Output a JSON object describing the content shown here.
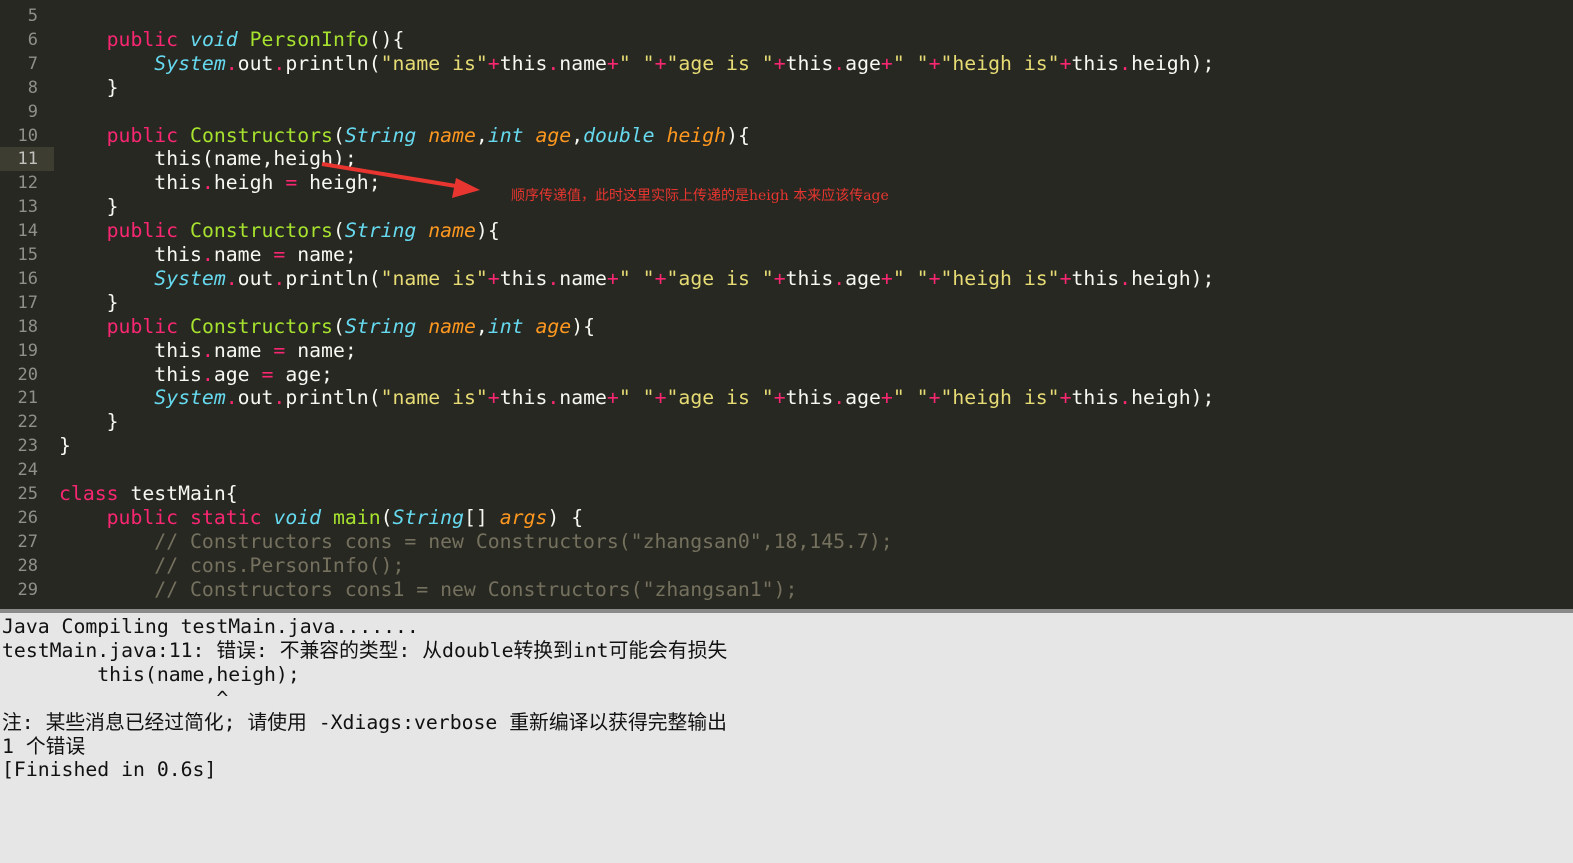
{
  "editor": {
    "current_line": 11,
    "lines": [
      {
        "n": "5",
        "tokens": []
      },
      {
        "n": "6",
        "tokens": [
          [
            "",
            "    "
          ],
          [
            "kw",
            "public"
          ],
          [
            "tx",
            " "
          ],
          [
            "ty",
            "void"
          ],
          [
            "tx",
            " "
          ],
          [
            "fn",
            "PersonInfo"
          ],
          [
            "tx",
            "(){"
          ]
        ]
      },
      {
        "n": "7",
        "tokens": [
          [
            "",
            "        "
          ],
          [
            "ty",
            "System"
          ],
          [
            "op",
            "."
          ],
          [
            "tx",
            "out"
          ],
          [
            "op",
            "."
          ],
          [
            "tx",
            "println("
          ],
          [
            "st",
            "\"name is\""
          ],
          [
            "op",
            "+"
          ],
          [
            "tx",
            "this"
          ],
          [
            "op",
            "."
          ],
          [
            "tx",
            "name"
          ],
          [
            "op",
            "+"
          ],
          [
            "st",
            "\" \""
          ],
          [
            "op",
            "+"
          ],
          [
            "st",
            "\"age is \""
          ],
          [
            "op",
            "+"
          ],
          [
            "tx",
            "this"
          ],
          [
            "op",
            "."
          ],
          [
            "tx",
            "age"
          ],
          [
            "op",
            "+"
          ],
          [
            "st",
            "\" \""
          ],
          [
            "op",
            "+"
          ],
          [
            "st",
            "\"heigh is\""
          ],
          [
            "op",
            "+"
          ],
          [
            "tx",
            "this"
          ],
          [
            "op",
            "."
          ],
          [
            "tx",
            "heigh);"
          ]
        ]
      },
      {
        "n": "8",
        "tokens": [
          [
            "",
            "    "
          ],
          [
            "tx",
            "}"
          ]
        ]
      },
      {
        "n": "9",
        "tokens": []
      },
      {
        "n": "10",
        "tokens": [
          [
            "",
            "    "
          ],
          [
            "kw",
            "public"
          ],
          [
            "tx",
            " "
          ],
          [
            "fn",
            "Constructors"
          ],
          [
            "tx",
            "("
          ],
          [
            "ty",
            "String"
          ],
          [
            "tx",
            " "
          ],
          [
            "pa",
            "name"
          ],
          [
            "tx",
            ","
          ],
          [
            "ty",
            "int"
          ],
          [
            "tx",
            " "
          ],
          [
            "pa",
            "age"
          ],
          [
            "tx",
            ","
          ],
          [
            "ty",
            "double"
          ],
          [
            "tx",
            " "
          ],
          [
            "pa",
            "heigh"
          ],
          [
            "tx",
            "){"
          ]
        ]
      },
      {
        "n": "11",
        "tokens": [
          [
            "",
            "        "
          ],
          [
            "tx",
            "this(name,heigh);"
          ]
        ]
      },
      {
        "n": "12",
        "tokens": [
          [
            "",
            "        "
          ],
          [
            "tx",
            "this"
          ],
          [
            "op",
            "."
          ],
          [
            "tx",
            "heigh "
          ],
          [
            "op",
            "="
          ],
          [
            "tx",
            " heigh;"
          ]
        ]
      },
      {
        "n": "13",
        "tokens": [
          [
            "",
            "    "
          ],
          [
            "tx",
            "}"
          ]
        ]
      },
      {
        "n": "14",
        "tokens": [
          [
            "",
            "    "
          ],
          [
            "kw",
            "public"
          ],
          [
            "tx",
            " "
          ],
          [
            "fn",
            "Constructors"
          ],
          [
            "tx",
            "("
          ],
          [
            "ty",
            "String"
          ],
          [
            "tx",
            " "
          ],
          [
            "pa",
            "name"
          ],
          [
            "tx",
            "){"
          ]
        ]
      },
      {
        "n": "15",
        "tokens": [
          [
            "",
            "        "
          ],
          [
            "tx",
            "this"
          ],
          [
            "op",
            "."
          ],
          [
            "tx",
            "name "
          ],
          [
            "op",
            "="
          ],
          [
            "tx",
            " name;"
          ]
        ]
      },
      {
        "n": "16",
        "tokens": [
          [
            "",
            "        "
          ],
          [
            "ty",
            "System"
          ],
          [
            "op",
            "."
          ],
          [
            "tx",
            "out"
          ],
          [
            "op",
            "."
          ],
          [
            "tx",
            "println("
          ],
          [
            "st",
            "\"name is\""
          ],
          [
            "op",
            "+"
          ],
          [
            "tx",
            "this"
          ],
          [
            "op",
            "."
          ],
          [
            "tx",
            "name"
          ],
          [
            "op",
            "+"
          ],
          [
            "st",
            "\" \""
          ],
          [
            "op",
            "+"
          ],
          [
            "st",
            "\"age is \""
          ],
          [
            "op",
            "+"
          ],
          [
            "tx",
            "this"
          ],
          [
            "op",
            "."
          ],
          [
            "tx",
            "age"
          ],
          [
            "op",
            "+"
          ],
          [
            "st",
            "\" \""
          ],
          [
            "op",
            "+"
          ],
          [
            "st",
            "\"heigh is\""
          ],
          [
            "op",
            "+"
          ],
          [
            "tx",
            "this"
          ],
          [
            "op",
            "."
          ],
          [
            "tx",
            "heigh);"
          ]
        ]
      },
      {
        "n": "17",
        "tokens": [
          [
            "",
            "    "
          ],
          [
            "tx",
            "}"
          ]
        ]
      },
      {
        "n": "18",
        "tokens": [
          [
            "",
            "    "
          ],
          [
            "kw",
            "public"
          ],
          [
            "tx",
            " "
          ],
          [
            "fn",
            "Constructors"
          ],
          [
            "tx",
            "("
          ],
          [
            "ty",
            "String"
          ],
          [
            "tx",
            " "
          ],
          [
            "pa",
            "name"
          ],
          [
            "tx",
            ","
          ],
          [
            "ty",
            "int"
          ],
          [
            "tx",
            " "
          ],
          [
            "pa",
            "age"
          ],
          [
            "tx",
            "){"
          ]
        ]
      },
      {
        "n": "19",
        "tokens": [
          [
            "",
            "        "
          ],
          [
            "tx",
            "this"
          ],
          [
            "op",
            "."
          ],
          [
            "tx",
            "name "
          ],
          [
            "op",
            "="
          ],
          [
            "tx",
            " name;"
          ]
        ]
      },
      {
        "n": "20",
        "tokens": [
          [
            "",
            "        "
          ],
          [
            "tx",
            "this"
          ],
          [
            "op",
            "."
          ],
          [
            "tx",
            "age "
          ],
          [
            "op",
            "="
          ],
          [
            "tx",
            " age;"
          ]
        ]
      },
      {
        "n": "21",
        "tokens": [
          [
            "",
            "        "
          ],
          [
            "ty",
            "System"
          ],
          [
            "op",
            "."
          ],
          [
            "tx",
            "out"
          ],
          [
            "op",
            "."
          ],
          [
            "tx",
            "println("
          ],
          [
            "st",
            "\"name is\""
          ],
          [
            "op",
            "+"
          ],
          [
            "tx",
            "this"
          ],
          [
            "op",
            "."
          ],
          [
            "tx",
            "name"
          ],
          [
            "op",
            "+"
          ],
          [
            "st",
            "\" \""
          ],
          [
            "op",
            "+"
          ],
          [
            "st",
            "\"age is \""
          ],
          [
            "op",
            "+"
          ],
          [
            "tx",
            "this"
          ],
          [
            "op",
            "."
          ],
          [
            "tx",
            "age"
          ],
          [
            "op",
            "+"
          ],
          [
            "st",
            "\" \""
          ],
          [
            "op",
            "+"
          ],
          [
            "st",
            "\"heigh is\""
          ],
          [
            "op",
            "+"
          ],
          [
            "tx",
            "this"
          ],
          [
            "op",
            "."
          ],
          [
            "tx",
            "heigh);"
          ]
        ]
      },
      {
        "n": "22",
        "tokens": [
          [
            "",
            "    "
          ],
          [
            "tx",
            "}"
          ]
        ]
      },
      {
        "n": "23",
        "tokens": [
          [
            "tx",
            "}"
          ]
        ]
      },
      {
        "n": "24",
        "tokens": []
      },
      {
        "n": "25",
        "tokens": [
          [
            "kw",
            "class"
          ],
          [
            "tx",
            " testMain{"
          ]
        ]
      },
      {
        "n": "26",
        "tokens": [
          [
            "",
            "    "
          ],
          [
            "kw",
            "public"
          ],
          [
            "tx",
            " "
          ],
          [
            "kw",
            "static"
          ],
          [
            "tx",
            " "
          ],
          [
            "ty",
            "void"
          ],
          [
            "tx",
            " "
          ],
          [
            "fn",
            "main"
          ],
          [
            "tx",
            "("
          ],
          [
            "ty",
            "String"
          ],
          [
            "tx",
            "[] "
          ],
          [
            "pa",
            "args"
          ],
          [
            "tx",
            ") {"
          ]
        ]
      },
      {
        "n": "27",
        "tokens": [
          [
            "",
            "        "
          ],
          [
            "cm",
            "// Constructors cons = new Constructors(\"zhangsan0\",18,145.7);"
          ]
        ]
      },
      {
        "n": "28",
        "tokens": [
          [
            "",
            "        "
          ],
          [
            "cm",
            "// cons.PersonInfo();"
          ]
        ]
      },
      {
        "n": "29",
        "tokens": [
          [
            "",
            "        "
          ],
          [
            "cm",
            "// Constructors cons1 = new Constructors(\"zhangsan1\");"
          ]
        ]
      }
    ],
    "annotation": {
      "text": "顺序传递值，此时这里实际上传递的是heigh 本来应该传age",
      "color": "#e8352f"
    }
  },
  "output": {
    "lines": [
      "Java Compiling testMain.java.......",
      "testMain.java:11: 错误: 不兼容的类型: 从double转换到int可能会有损失",
      "        this(name,heigh);",
      "                  ^",
      "注: 某些消息已经过简化; 请使用 -Xdiags:verbose 重新编译以获得完整输出",
      "1 个错误",
      "[Finished in 0.6s]"
    ]
  }
}
